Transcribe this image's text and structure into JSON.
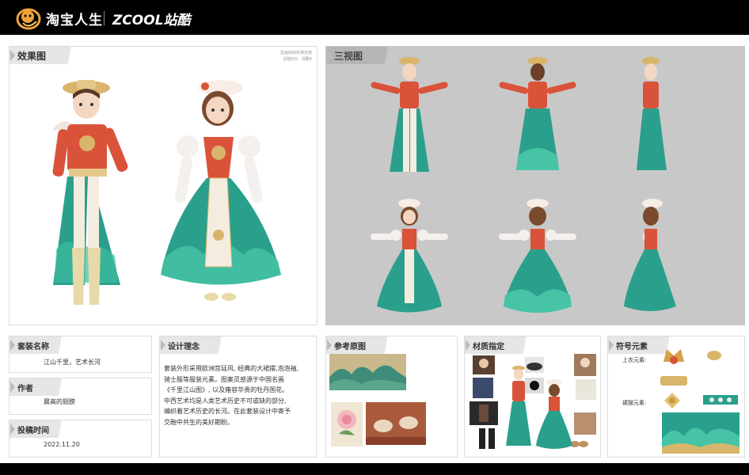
{
  "header": {
    "brand_primary": "淘宝人生",
    "brand_secondary": "ZCOOL站酷",
    "logo_icon": "taobao-life-logo-icon",
    "background": "#000000"
  },
  "effect_panel": {
    "title": "效果图",
    "note_line1": "显画绘制标准自我",
    "note_line2": "创建9分，请删0"
  },
  "threeview_panel": {
    "title": "三视图",
    "background": "#c8c8c8"
  },
  "info": {
    "name_label": "套装名称",
    "name_value": "江山千里，艺术长河",
    "author_label": "作者",
    "author_value": "晨高的翅膀",
    "date_label": "投稿时间",
    "date_value": "2022.11.20"
  },
  "concept": {
    "title": "设计理念",
    "line1": "套装外形采用欧洲宫廷风, 经典的大裙摆,泡泡袖,",
    "line2": "骑士服等服装元素。图案灵感源于中国名画",
    "line3": "《千里江山图》, 以及雍容华贵的牡丹国花。",
    "line4": "中西艺术均是人类艺术历史不可或缺的部分,",
    "line5": "编织着艺术历史的长河。在此套装设计中寄予",
    "line6": "交融中共生的美好期盼。"
  },
  "reference": {
    "title": "参考原图"
  },
  "material": {
    "title": "材质指定"
  },
  "symbol": {
    "title": "符号元素",
    "top_label": "上衣元素:",
    "skirt_label": "裙摆元素:"
  },
  "colors": {
    "teal": "#2aa08c",
    "red": "#d9533a",
    "gold": "#d8b56a",
    "cream": "#f3ead8",
    "panel_gray": "#c8c8c8"
  }
}
